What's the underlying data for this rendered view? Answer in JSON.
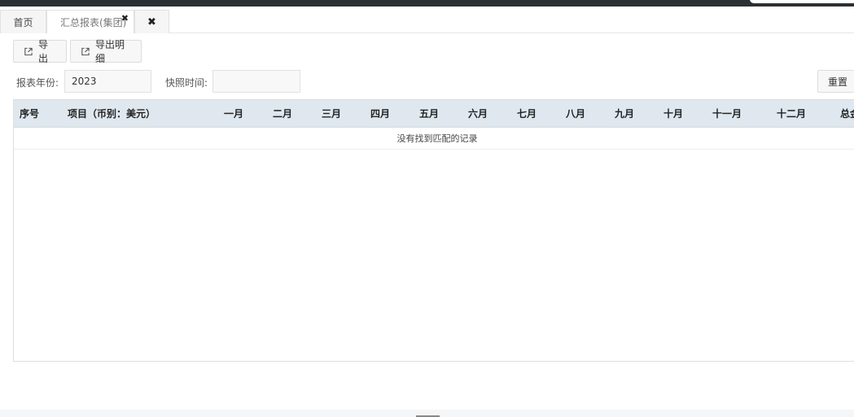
{
  "tabs": {
    "home": "首页",
    "active": "汇总报表(集团)",
    "active_close": "✖",
    "close_all": "✖"
  },
  "toolbar": {
    "export_label": "导出",
    "export_detail_label": "导出明细"
  },
  "filters": {
    "year_label": "报表年份:",
    "year_value": "2023",
    "snapshot_label": "快照时间:",
    "snapshot_value": "",
    "reset_label": "重置"
  },
  "table": {
    "columns": [
      "序号",
      "项目（币别：美元）",
      "一月",
      "二月",
      "三月",
      "四月",
      "五月",
      "六月",
      "七月",
      "八月",
      "九月",
      "十月",
      "十一月",
      "十二月",
      "总金"
    ],
    "empty_text": "没有找到匹配的记录"
  },
  "icons": {
    "export": "export-icon",
    "close": "close-icon"
  }
}
